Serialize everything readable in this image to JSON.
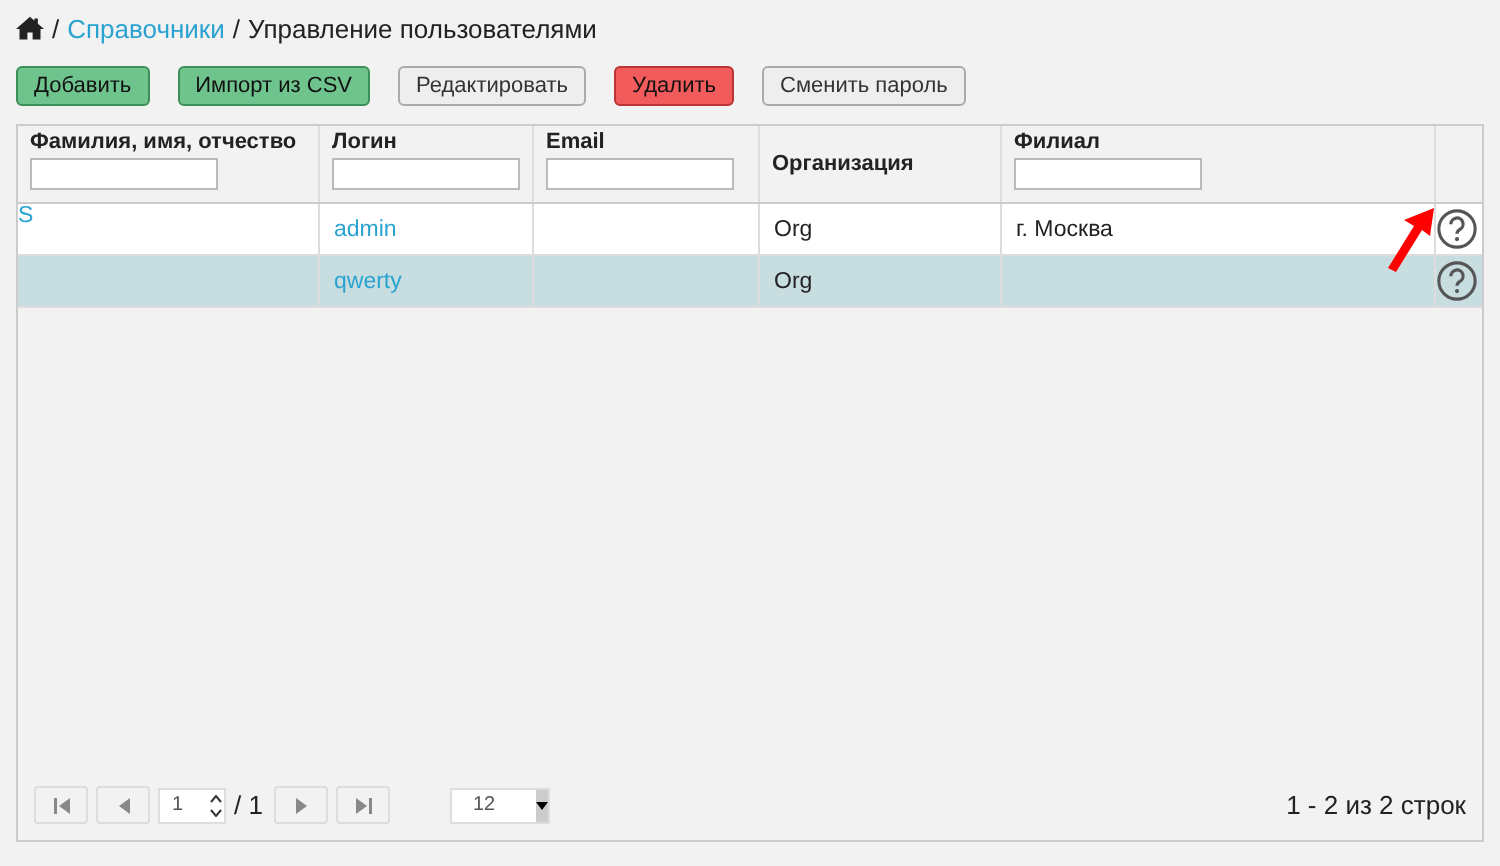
{
  "breadcrumb": [
    {
      "kind": "home"
    },
    {
      "kind": "sep",
      "label": "/"
    },
    {
      "kind": "link",
      "label": "Справочники"
    },
    {
      "kind": "sep",
      "label": "/"
    },
    {
      "kind": "text",
      "label": "Управление пользователями"
    }
  ],
  "toolbar": [
    {
      "label": "Добавить",
      "kind": "success"
    },
    {
      "label": "Импорт из CSV",
      "kind": "success"
    },
    {
      "label": "Редактировать",
      "kind": "default"
    },
    {
      "label": "Удалить",
      "kind": "danger"
    },
    {
      "label": "Сменить пароль",
      "kind": "default"
    }
  ],
  "table": {
    "columns": [
      {
        "label": "Фамилия, имя, отчество",
        "filter": true
      },
      {
        "label": "Логин",
        "filter": true
      },
      {
        "label": "Email",
        "filter": true
      },
      {
        "label": "Организация",
        "filter": false
      },
      {
        "label": "Филиал",
        "filter": true
      }
    ],
    "rows": [
      {
        "selected": false,
        "cells": [
          "S",
          "admin",
          "",
          "Org",
          "г. Москва"
        ],
        "pointer": true
      },
      {
        "selected": true,
        "cells": [
          "",
          "qwerty",
          "",
          "Org",
          ""
        ],
        "pointer": false
      }
    ]
  },
  "pager": {
    "page": "1",
    "total": "/ 1",
    "page_size": "12",
    "summary": "1 - 2 из 2 строк"
  }
}
